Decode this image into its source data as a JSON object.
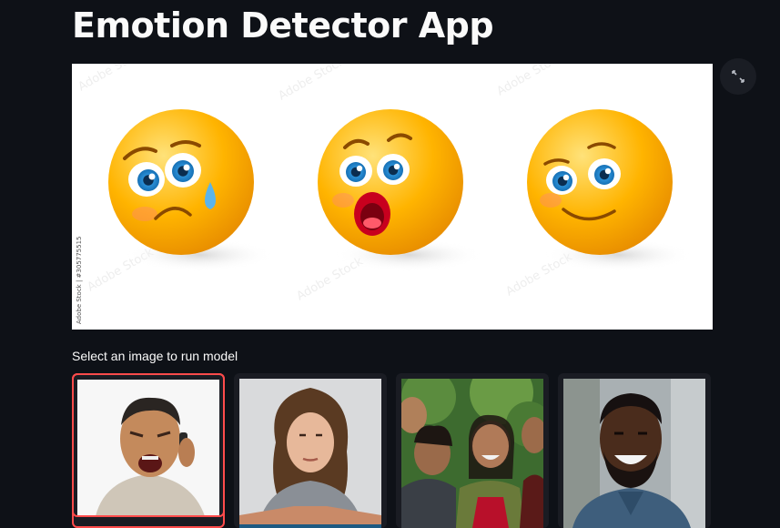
{
  "app": {
    "title": "Emotion Detector App"
  },
  "banner": {
    "alt": "emotion emoji faces: sad, surprised, happy",
    "watermark": "Adobe Stock | #305775515",
    "faces": [
      "sad",
      "surprised",
      "happy"
    ]
  },
  "controls": {
    "fullscreen_icon": "expand-icon"
  },
  "gallery": {
    "label": "Select an image to run model",
    "selected_index": 0,
    "items": [
      {
        "description": "angry man on phone"
      },
      {
        "description": "woman with brown hair, arms crossed"
      },
      {
        "description": "group of laughing friends"
      },
      {
        "description": "smiling bearded man"
      }
    ]
  },
  "colors": {
    "background": "#0e1117",
    "accent": "#ff4b4b",
    "text": "#fafafa"
  }
}
